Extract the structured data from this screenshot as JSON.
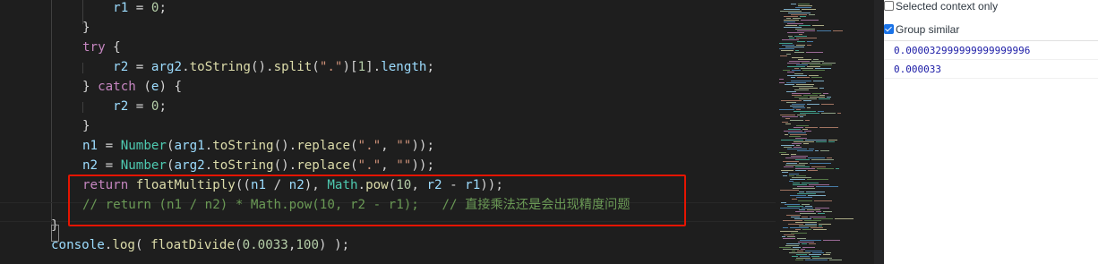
{
  "editor": {
    "lines": [
      {
        "segs": [
          {
            "t": "    r1 ",
            "c": "var"
          },
          {
            "t": "= ",
            "c": "p"
          },
          {
            "t": "0",
            "c": "num"
          },
          {
            "t": ";",
            "c": "p"
          }
        ]
      },
      {
        "segs": [
          {
            "t": "}",
            "c": "p"
          }
        ]
      },
      {
        "segs": [
          {
            "t": "try",
            "c": "ctl"
          },
          {
            "t": " {",
            "c": "p"
          }
        ]
      },
      {
        "segs": [
          {
            "t": "    r2 ",
            "c": "var"
          },
          {
            "t": "= ",
            "c": "p"
          },
          {
            "t": "arg2",
            "c": "var"
          },
          {
            "t": ".",
            "c": "p"
          },
          {
            "t": "toString",
            "c": "fn"
          },
          {
            "t": "().",
            "c": "p"
          },
          {
            "t": "split",
            "c": "fn"
          },
          {
            "t": "(",
            "c": "p"
          },
          {
            "t": "\".\"",
            "c": "str"
          },
          {
            "t": ")[",
            "c": "p"
          },
          {
            "t": "1",
            "c": "num"
          },
          {
            "t": "].",
            "c": "p"
          },
          {
            "t": "length",
            "c": "var"
          },
          {
            "t": ";",
            "c": "p"
          }
        ]
      },
      {
        "segs": [
          {
            "t": "} ",
            "c": "p"
          },
          {
            "t": "catch",
            "c": "ctl"
          },
          {
            "t": " (",
            "c": "p"
          },
          {
            "t": "e",
            "c": "var"
          },
          {
            "t": ") {",
            "c": "p"
          }
        ]
      },
      {
        "segs": [
          {
            "t": "    r2 ",
            "c": "var"
          },
          {
            "t": "= ",
            "c": "p"
          },
          {
            "t": "0",
            "c": "num"
          },
          {
            "t": ";",
            "c": "p"
          }
        ]
      },
      {
        "segs": [
          {
            "t": "}",
            "c": "p"
          }
        ]
      },
      {
        "segs": [
          {
            "t": "n1 ",
            "c": "var"
          },
          {
            "t": "= ",
            "c": "p"
          },
          {
            "t": "Number",
            "c": "type"
          },
          {
            "t": "(",
            "c": "p"
          },
          {
            "t": "arg1",
            "c": "var"
          },
          {
            "t": ".",
            "c": "p"
          },
          {
            "t": "toString",
            "c": "fn"
          },
          {
            "t": "().",
            "c": "p"
          },
          {
            "t": "replace",
            "c": "fn"
          },
          {
            "t": "(",
            "c": "p"
          },
          {
            "t": "\".\"",
            "c": "str"
          },
          {
            "t": ", ",
            "c": "p"
          },
          {
            "t": "\"\"",
            "c": "str"
          },
          {
            "t": "));",
            "c": "p"
          }
        ]
      },
      {
        "segs": [
          {
            "t": "n2 ",
            "c": "var"
          },
          {
            "t": "= ",
            "c": "p"
          },
          {
            "t": "Number",
            "c": "type"
          },
          {
            "t": "(",
            "c": "p"
          },
          {
            "t": "arg2",
            "c": "var"
          },
          {
            "t": ".",
            "c": "p"
          },
          {
            "t": "toString",
            "c": "fn"
          },
          {
            "t": "().",
            "c": "p"
          },
          {
            "t": "replace",
            "c": "fn"
          },
          {
            "t": "(",
            "c": "p"
          },
          {
            "t": "\".\"",
            "c": "str"
          },
          {
            "t": ", ",
            "c": "p"
          },
          {
            "t": "\"\"",
            "c": "str"
          },
          {
            "t": "));",
            "c": "p"
          }
        ]
      },
      {
        "segs": [
          {
            "t": "return",
            "c": "ctl"
          },
          {
            "t": " ",
            "c": "p"
          },
          {
            "t": "floatMultiply",
            "c": "fn"
          },
          {
            "t": "((",
            "c": "p"
          },
          {
            "t": "n1",
            "c": "var"
          },
          {
            "t": " / ",
            "c": "p"
          },
          {
            "t": "n2",
            "c": "var"
          },
          {
            "t": "), ",
            "c": "p"
          },
          {
            "t": "Math",
            "c": "type"
          },
          {
            "t": ".",
            "c": "p"
          },
          {
            "t": "pow",
            "c": "fn"
          },
          {
            "t": "(",
            "c": "p"
          },
          {
            "t": "10",
            "c": "num"
          },
          {
            "t": ", ",
            "c": "p"
          },
          {
            "t": "r2",
            "c": "var"
          },
          {
            "t": " - ",
            "c": "p"
          },
          {
            "t": "r1",
            "c": "var"
          },
          {
            "t": "));",
            "c": "p"
          }
        ]
      },
      {
        "segs": [
          {
            "t": "// return (n1 / n2) * Math.pow(10, r2 - r1);   // 直接乘法还是会出现精度问题",
            "c": "cmt"
          }
        ]
      },
      {
        "segs": [
          {
            "t": "}",
            "c": "p"
          }
        ]
      },
      {
        "segs": [
          {
            "t": "console",
            "c": "var"
          },
          {
            "t": ".",
            "c": "p"
          },
          {
            "t": "log",
            "c": "fn"
          },
          {
            "t": "( ",
            "c": "p"
          },
          {
            "t": "floatDivide",
            "c": "fn"
          },
          {
            "t": "(",
            "c": "p"
          },
          {
            "t": "0.0033",
            "c": "num"
          },
          {
            "t": ",",
            "c": "p"
          },
          {
            "t": "100",
            "c": "num"
          },
          {
            "t": ") );",
            "c": "p"
          }
        ]
      }
    ]
  },
  "console": {
    "selected_context_label": "Selected context only",
    "selected_context_checked": false,
    "group_similar_label": "Group similar",
    "group_similar_checked": true,
    "messages": [
      "0.000032999999999999996",
      "0.000033"
    ]
  },
  "colors": {
    "highlight_box": "#e51400"
  }
}
